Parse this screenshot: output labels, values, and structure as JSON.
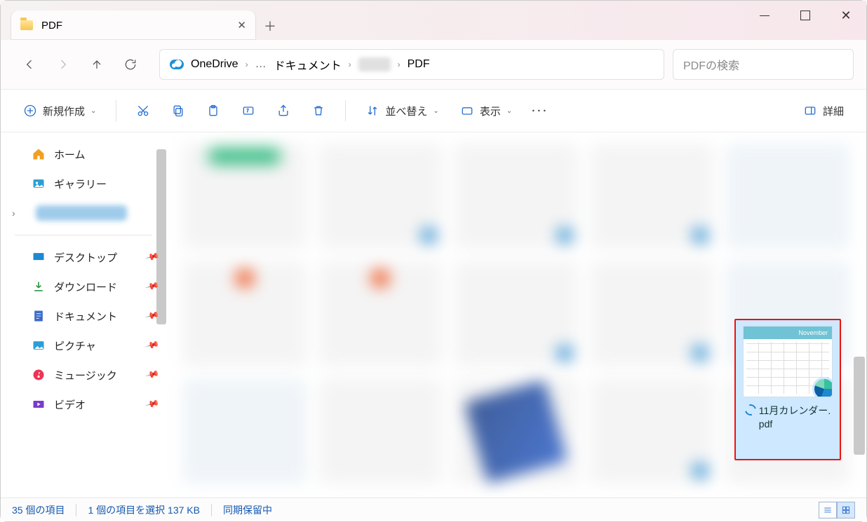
{
  "tab": {
    "title": "PDF"
  },
  "breadcrumb": {
    "root": "OneDrive",
    "seg2": "ドキュメント",
    "seg4": "PDF"
  },
  "search": {
    "placeholder": "PDFの検索"
  },
  "toolbar": {
    "new": "新規作成",
    "sort": "並べ替え",
    "view": "表示",
    "details": "詳細"
  },
  "sidebar": {
    "home": "ホーム",
    "gallery": "ギャラリー",
    "desktop": "デスクトップ",
    "downloads": "ダウンロード",
    "documents": "ドキュメント",
    "pictures": "ピクチャ",
    "music": "ミュージック",
    "videos": "ビデオ"
  },
  "selected_file": {
    "name_line1": "11月カレンダー.",
    "name_line2": "pdf",
    "thumb_header": "November"
  },
  "status": {
    "count": "35 個の項目",
    "selection": "1 個の項目を選択 137 KB",
    "sync": "同期保留中"
  }
}
